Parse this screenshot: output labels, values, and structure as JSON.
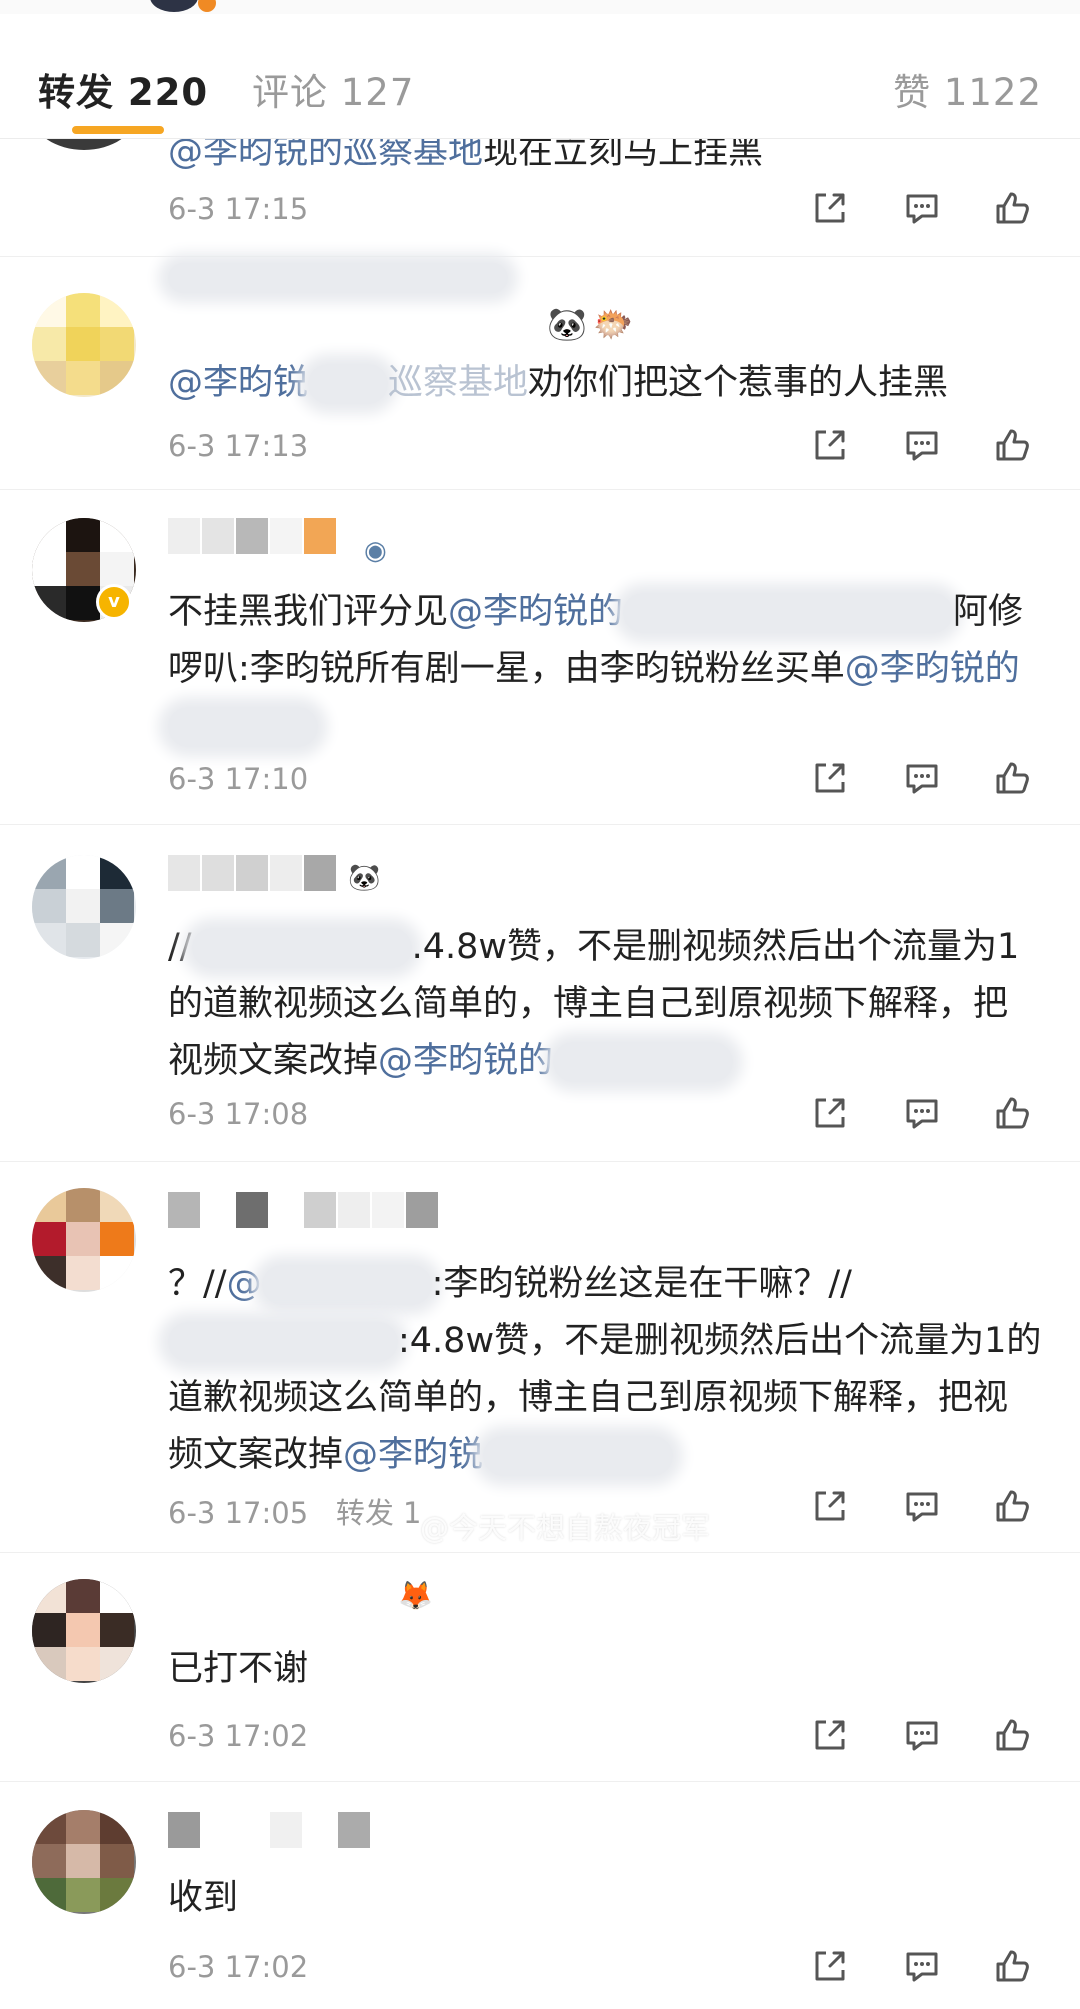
{
  "tabs": {
    "repost": "转发 220",
    "comment": "评论 127",
    "like": "赞 1122"
  },
  "accent_color": "#f6a623",
  "mention_color": "#4f6f9d",
  "items": [
    {
      "text_mention": "@李昀锐的巡察基地",
      "text_rest": "现在立刻马上挂黑",
      "time": "6-3 17:15"
    },
    {
      "emoji1": "🐼",
      "emoji2": "🐡",
      "mention1": "@李昀锐",
      "mention2": "巡察基地",
      "text_rest": "劝你们把这个惹事的人挂黑",
      "time": "6-3 17:13"
    },
    {
      "badge": "v",
      "t1": "不挂黑我们评分见",
      "mention1": "@李昀锐的",
      "t2": "阿修啰叭:李昀锐所有剧一星，由李昀锐粉丝买单",
      "mention2": "@李昀锐的",
      "time": "6-3 17:10"
    },
    {
      "emoji1": "🐼",
      "t1": "//",
      "t2": ".4.8w赞，不是删视频然后出个流量为1的道歉视频这么简单的，博主自己到原视频下解释，把视频文案改掉",
      "mention1": "@李昀锐的",
      "time": "6-3 17:08"
    },
    {
      "t1": "？//",
      "mention1": "@",
      "t2": ":李昀锐粉丝这是在干嘛？//",
      "t3": ":4.8w赞，不是删视频然后出个流量为1的道歉视频这么简单的，博主自己到原视频下解释，把视频文案改掉",
      "mention2": "@李昀锐",
      "time": "6-3 17:05",
      "reposts": "转发 1"
    },
    {
      "emoji1": "🦊",
      "text": "已打不谢",
      "time": "6-3 17:02"
    },
    {
      "text": "收到",
      "time": "6-3 17:02"
    }
  ],
  "watermark": "@今天不想自熬夜冠军",
  "icons": [
    "share-icon",
    "comment-icon",
    "like-icon"
  ]
}
